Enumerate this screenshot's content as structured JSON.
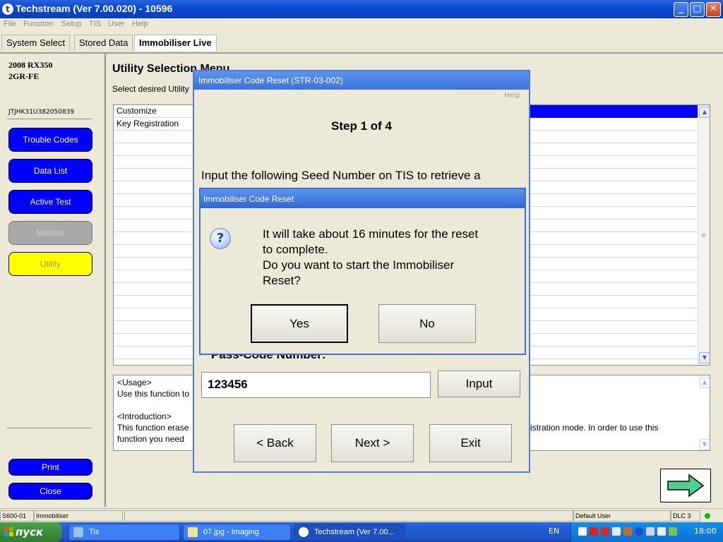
{
  "window": {
    "title": "Techstream (Ver 7.00.020) - 10596"
  },
  "menu": [
    "File",
    "Function",
    "Setup",
    "TIS",
    "User",
    "Help"
  ],
  "tabs": [
    "System Select",
    "Stored Data",
    "Immobiliser Live"
  ],
  "vehicle": {
    "model": "2008 RX350",
    "engine": "2GR-FE",
    "vin": "JTJHK31U382050839"
  },
  "nav": {
    "trouble_codes": "Trouble Codes",
    "data_list": "Data List",
    "active_test": "Active Test",
    "monitor": "Monitor",
    "utility": "Utility",
    "print": "Print",
    "close": "Close"
  },
  "utility": {
    "title": "Utility Selection Menu",
    "subtitle": "Select desired Utility",
    "list": [
      "Customize",
      "Key Registration"
    ],
    "usage_heading": "<Usage>",
    "usage_text": "Use this function to",
    "intro_heading": "<Introduction>",
    "intro_line1": "This function erase",
    "intro_line1_end": "istration mode. In order to use this",
    "intro_line2": "function you need"
  },
  "reset_dialog": {
    "title": "Immobiliser Code Reset (STR-03-002)",
    "help": "Help",
    "step": "Step 1 of 4",
    "instruction": "Input the following Seed Number on TIS to retrieve a",
    "pass_code_label": "Pass-Code Number:",
    "pass_code_value": "123456",
    "input_label": "Input",
    "back_label": "< Back",
    "next_label": "Next >",
    "exit_label": "Exit"
  },
  "confirm_dialog": {
    "title": "Immobiliser Code Reset",
    "message_line1": "It will take about 16 minutes for the reset",
    "message_line2": "to complete.",
    "message_line3": "Do you want to start the Immobiliser",
    "message_line4": "Reset?",
    "yes_label": "Yes",
    "no_label": "No"
  },
  "status": {
    "code": "S600-01",
    "mode": "Immobiliser",
    "user": "Default User",
    "dlc": "DLC 3"
  },
  "taskbar": {
    "start": "пуск",
    "items": [
      "Tis",
      "07.jpg - Imaging",
      "Techstream (Ver 7.00..."
    ],
    "lang": "EN",
    "clock": "18:00"
  },
  "colors": {
    "nav_blue": "#0000ff",
    "utility_yellow": "#ffff00",
    "status_green": "#00c000",
    "xp_title_blue": "#0a4bd6"
  }
}
